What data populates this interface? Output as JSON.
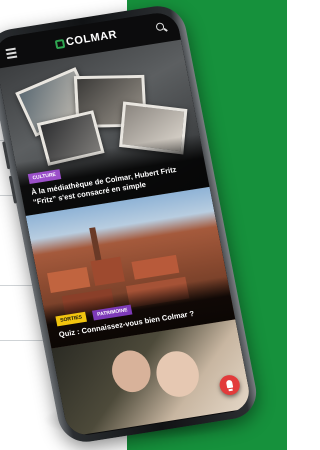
{
  "app": {
    "logo_text": "COLMAR",
    "menu_icon": "menu-icon",
    "search_icon": "search-icon"
  },
  "feed": [
    {
      "tags": [
        "CULTURE"
      ],
      "headline": "À la médiathèque de Colmar, Hubert Fritz “Fritz” s'est consacré en simple"
    },
    {
      "tags": [
        "SORTIES",
        "PATRIMOINE"
      ],
      "headline": "Quiz : Connaissez-vous bien Colmar ?"
    },
    {
      "tags": [],
      "headline": ""
    }
  ],
  "fab": {
    "icon": "microphone-icon"
  },
  "colors": {
    "brand_green": "#16913c",
    "tag_purple": "#9b4fc9",
    "tag_yellow": "#f1c40f",
    "fab_red": "#e23b3b"
  }
}
